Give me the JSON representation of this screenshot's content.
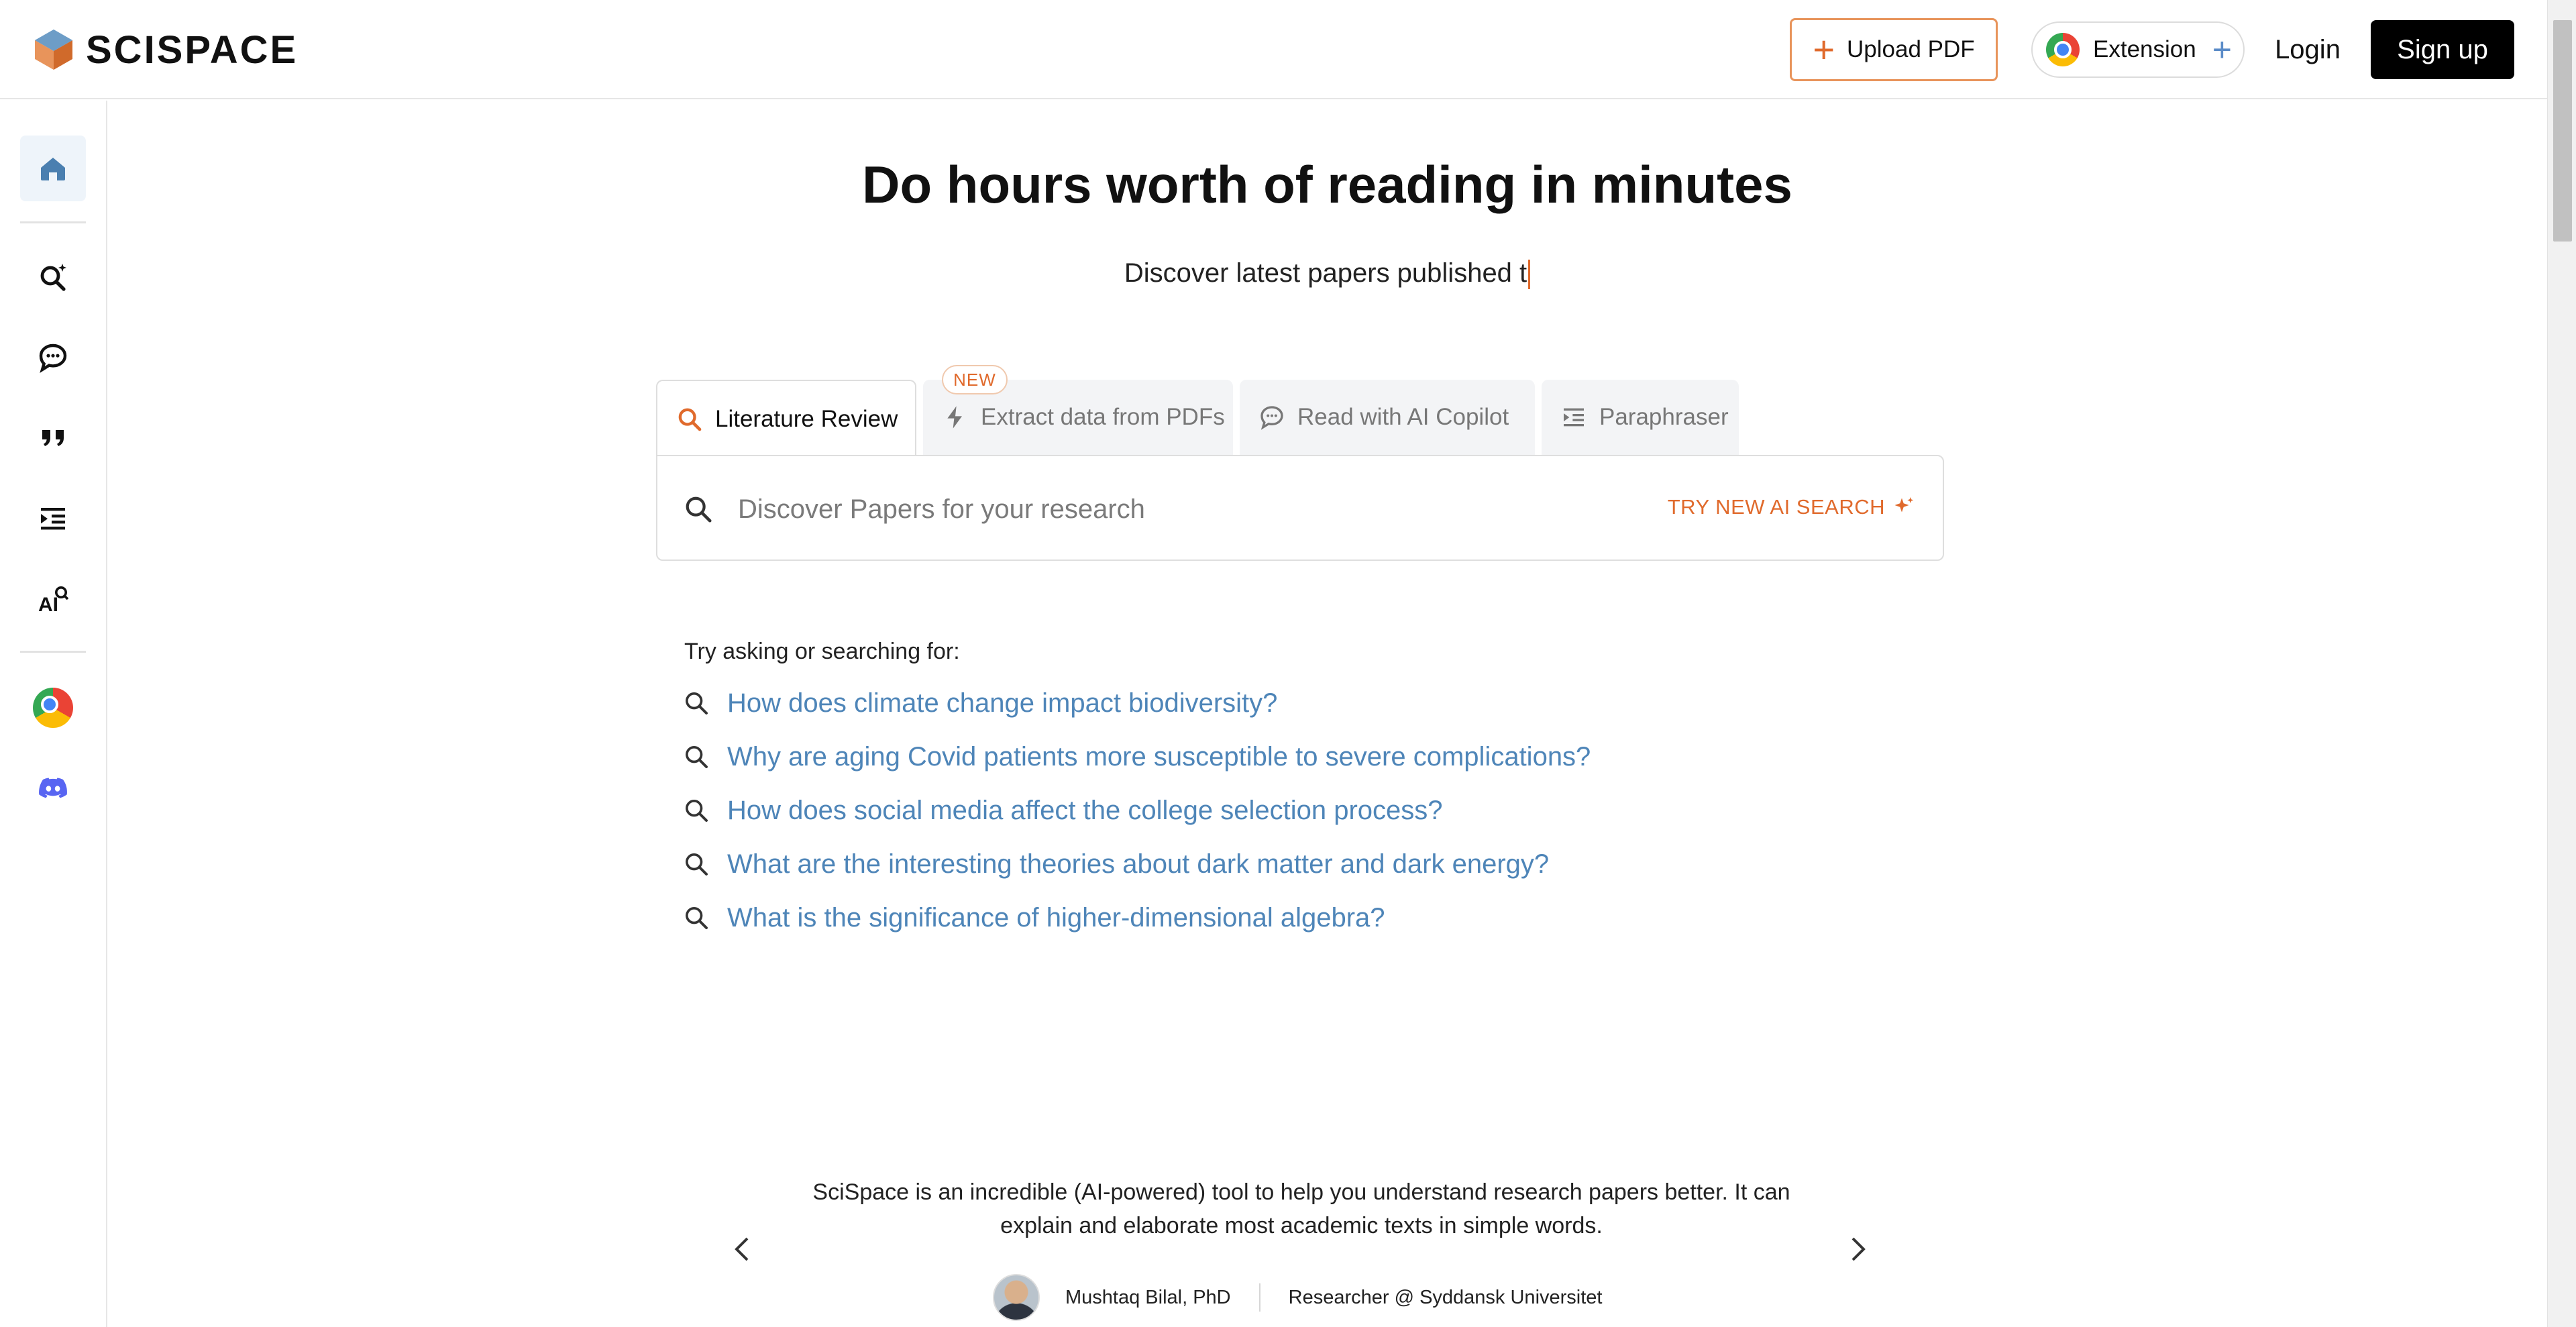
{
  "header": {
    "brand": "SCISPACE",
    "upload_label": "Upload PDF",
    "extension_label": "Extension",
    "login_label": "Login",
    "signup_label": "Sign up"
  },
  "sidebar": {
    "items": [
      {
        "name": "home",
        "icon": "home-icon",
        "active": true
      },
      {
        "name": "literature-search",
        "icon": "search-sparkle-icon"
      },
      {
        "name": "ai-copilot",
        "icon": "chat-bubble-icon"
      },
      {
        "name": "citation",
        "icon": "quote-icon"
      },
      {
        "name": "paraphraser",
        "icon": "indent-list-icon"
      },
      {
        "name": "ai-detector",
        "icon": "ai-detect-icon"
      },
      {
        "name": "chrome-extension",
        "icon": "chrome-icon"
      },
      {
        "name": "discord",
        "icon": "discord-icon"
      }
    ]
  },
  "hero": {
    "title": "Do hours worth of reading in minutes",
    "subtitle": "Discover latest papers published t"
  },
  "tabs": [
    {
      "label": "Literature Review",
      "icon": "search-icon",
      "active": true
    },
    {
      "label": "Extract data from PDFs",
      "icon": "bolt-icon",
      "badge": "NEW"
    },
    {
      "label": "Read with AI Copilot",
      "icon": "chat-bubble-icon"
    },
    {
      "label": "Paraphraser",
      "icon": "indent-list-icon"
    }
  ],
  "search": {
    "placeholder": "Discover Papers for your research",
    "value": "",
    "ai_search_label": "TRY NEW AI SEARCH"
  },
  "suggestions": {
    "label": "Try asking or searching for:",
    "items": [
      "How does climate change impact biodiversity?",
      "Why are aging Covid patients more susceptible to severe complications?",
      "How does social media affect the college selection process?",
      "What are the interesting theories about dark matter and dark energy?",
      "What is the significance of higher-dimensional algebra?"
    ]
  },
  "testimonial": {
    "quote": "SciSpace is an incredible (AI-powered) tool to help you understand research papers better. It can explain and elaborate most academic texts in simple words.",
    "author": "Mushtaq Bilal, PhD",
    "role": "Researcher @ Syddansk Universitet"
  },
  "colors": {
    "accent": "#e06a2c",
    "link": "#4e85b8",
    "primary_button": "#000000",
    "active_nav_bg": "#eef4fa"
  }
}
